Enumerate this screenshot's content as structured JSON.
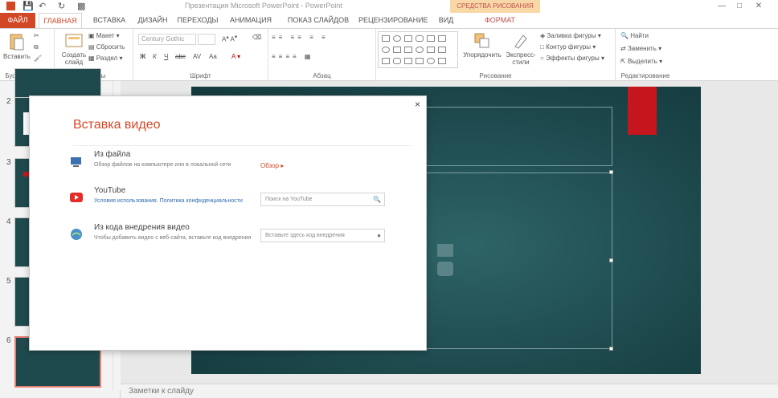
{
  "window": {
    "doc_title": "Презентация Microsoft PowerPoint - PowerPoint",
    "contextual_tab": "СРЕДСТВА РИСОВАНИЯ"
  },
  "tabs": [
    "ФАЙЛ",
    "ГЛАВНАЯ",
    "ВСТАВКА",
    "ДИЗАЙН",
    "ПЕРЕХОДЫ",
    "АНИМАЦИЯ",
    "ПОКАЗ СЛАЙДОВ",
    "РЕЦЕНЗИРОВАНИЕ",
    "ВИД",
    "ФОРМАТ"
  ],
  "ribbon": {
    "clipboard": {
      "paste": "Вставить",
      "label": "Буфер обмена"
    },
    "slides": {
      "new_slide": "Создать слайд",
      "layout": "Макет",
      "reset": "Сбросить",
      "section": "Раздел",
      "label": "Слайды"
    },
    "font": {
      "font_name": "Century Gothic",
      "label": "Шрифт"
    },
    "paragraph": {
      "label": "Абзац"
    },
    "drawing": {
      "arrange": "Упорядочить",
      "quick_styles": "Экспресс-стили",
      "fill": "Заливка фигуры",
      "outline": "Контур фигуры",
      "effects": "Эффекты фигуры",
      "label": "Рисование"
    },
    "editing": {
      "find": "Найти",
      "replace": "Заменить",
      "select": "Выделить",
      "label": "Редактирование"
    }
  },
  "thumbnails": {
    "numbers": [
      "2",
      "3",
      "4",
      "5",
      "6"
    ]
  },
  "notes": {
    "label": "Заметки к слайду"
  },
  "dialog": {
    "title": "Вставка видео",
    "close": "×",
    "from_file": {
      "title": "Из файла",
      "desc": "Обзор файлов на компьютере или в локальной сети",
      "browse": "Обзор ▸"
    },
    "youtube": {
      "title": "YouTube",
      "desc": "Условия использования. Политика конфиденциальности",
      "placeholder": "Поиск на YouTube"
    },
    "embed": {
      "title": "Из кода внедрения видео",
      "desc": "Чтобы добавить видео с веб-сайта, вставьте код внедрения",
      "placeholder": "Вставьте здесь код внедрения"
    }
  }
}
